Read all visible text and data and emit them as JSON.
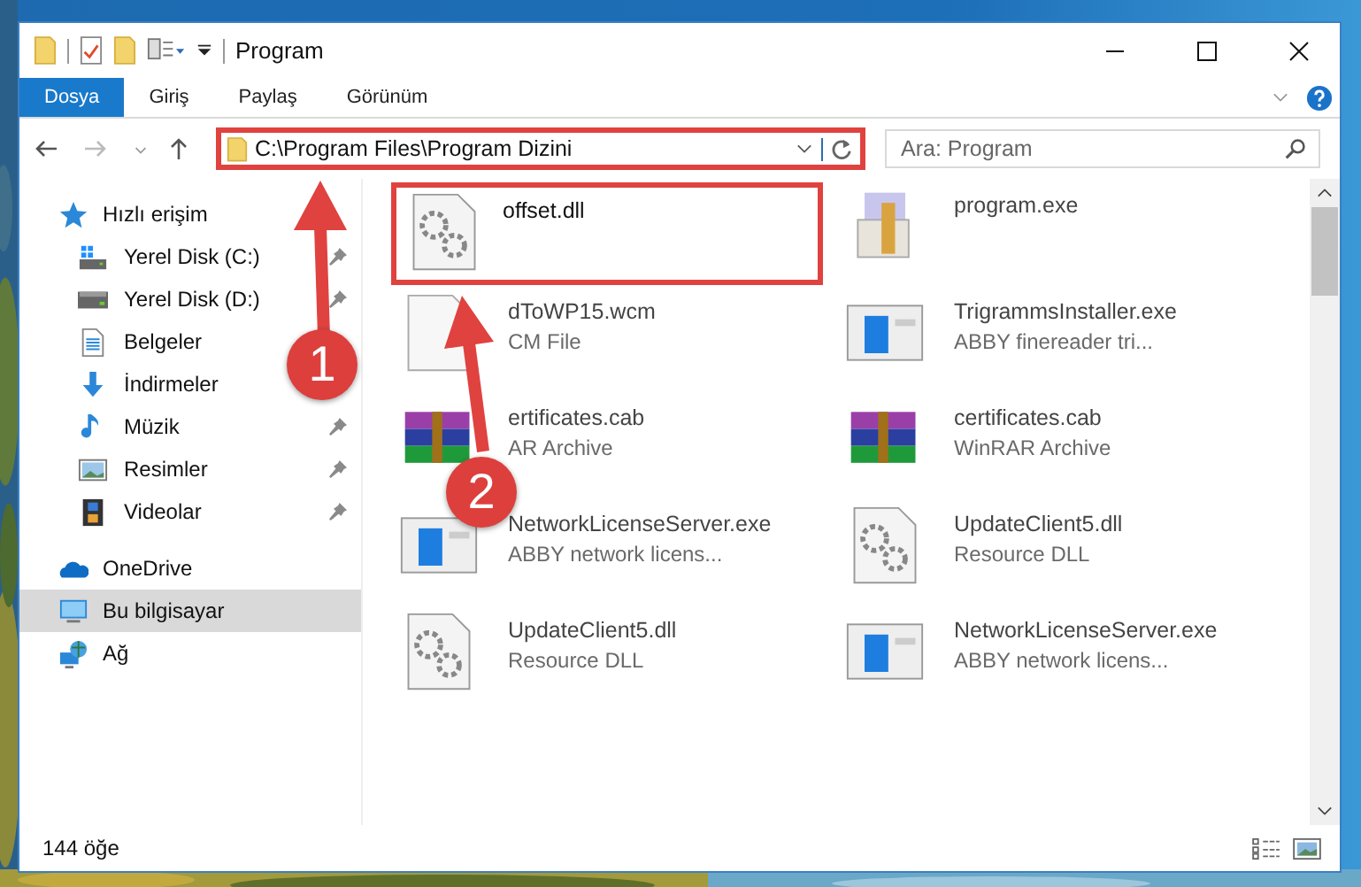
{
  "window": {
    "title": "Program"
  },
  "ribbon_tabs": [
    {
      "label": "Dosya",
      "selected": true
    },
    {
      "label": "Giriş",
      "selected": false
    },
    {
      "label": "Paylaş",
      "selected": false
    },
    {
      "label": "Görünüm",
      "selected": false
    }
  ],
  "address_bar": {
    "value": "C:\\Program Files\\Program Dizini",
    "highlighted": true
  },
  "search": {
    "placeholder": "Ara: Program"
  },
  "sidebar": {
    "items": [
      {
        "label": "Hızlı erişim",
        "selected": false,
        "children": [
          {
            "label": "Yerel Disk (C:)",
            "pinned": true,
            "selected": false
          },
          {
            "label": "Yerel Disk (D:)",
            "pinned": true,
            "selected": false
          },
          {
            "label": "Belgeler",
            "pinned": false,
            "selected": false
          },
          {
            "label": "İndirmeler",
            "pinned": false,
            "selected": false
          },
          {
            "label": "Müzik",
            "pinned": true,
            "selected": false
          },
          {
            "label": "Resimler",
            "pinned": true,
            "selected": false
          },
          {
            "label": "Videolar",
            "pinned": true,
            "selected": false
          }
        ]
      },
      {
        "label": "OneDrive",
        "selected": false
      },
      {
        "label": "Bu bilgisayar",
        "selected": true
      },
      {
        "label": "Ağ",
        "selected": false
      }
    ]
  },
  "files": [
    {
      "name": "offset.dll",
      "kind": "dll",
      "highlighted": true
    },
    {
      "name": "program.exe",
      "kind": "setup",
      "highlighted": false
    },
    {
      "name": "dToWP15.wcm",
      "type": "CM File",
      "kind": "blank",
      "highlighted": false
    },
    {
      "name": "TrigrammsInstaller.exe",
      "type": "ABBY finereader tri...",
      "kind": "app",
      "highlighted": false
    },
    {
      "name": "ertificates.cab",
      "type": "AR Archive",
      "kind": "rar",
      "highlighted": false
    },
    {
      "name": "certificates.cab",
      "type": "WinRAR Archive",
      "kind": "rar",
      "highlighted": false
    },
    {
      "name": "NetworkLicenseServer.exe",
      "type": "ABBY network licens...",
      "kind": "app",
      "highlighted": false
    },
    {
      "name": "UpdateClient5.dll",
      "type": "Resource DLL",
      "kind": "dll",
      "highlighted": false
    },
    {
      "name": "UpdateClient5.dll",
      "type": "Resource DLL",
      "kind": "dll",
      "highlighted": false
    },
    {
      "name": "NetworkLicenseServer.exe",
      "type": "ABBY network licens...",
      "kind": "app",
      "highlighted": false
    }
  ],
  "status_bar": {
    "item_count": "144 öğe"
  },
  "callouts": [
    "1",
    "2"
  ]
}
